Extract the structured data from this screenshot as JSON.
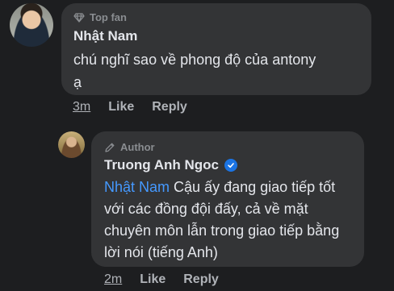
{
  "comment": {
    "badge": "Top fan",
    "author": "Nhật Nam",
    "text_lines": [
      "chú nghĩ sao về phong độ của antony",
      "ạ"
    ],
    "time": "3m",
    "like_label": "Like",
    "reply_label": "Reply"
  },
  "reply": {
    "badge": "Author",
    "author": "Truong Anh Ngoc",
    "mention": "Nhật Nam",
    "text": " Cậu ấy đang giao tiếp tốt với các đồng đội đấy, cả về mặt chuyên môn lẫn trong giao tiếp bằng lời nói (tiếng Anh)",
    "time": "2m",
    "like_label": "Like",
    "reply_label": "Reply"
  },
  "colors": {
    "background": "#1d1e20",
    "bubble": "#333436",
    "mention": "#4599ff",
    "verified": "#1b74e4"
  }
}
